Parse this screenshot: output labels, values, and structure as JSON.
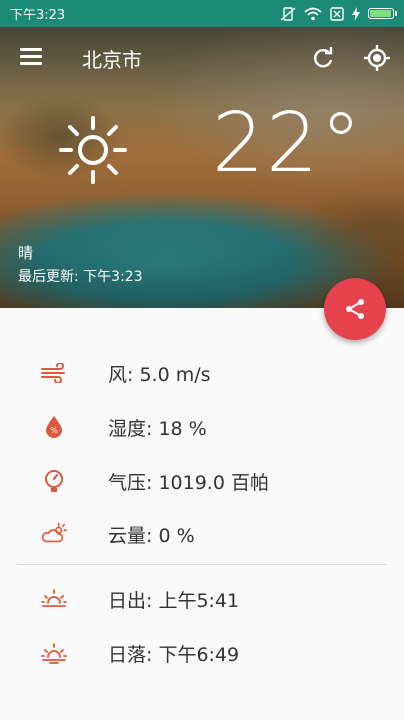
{
  "status_bar": {
    "time": "下午3:23"
  },
  "app_bar": {
    "city": "北京市",
    "icons": [
      "menu-icon",
      "refresh-icon",
      "location-icon"
    ]
  },
  "current": {
    "temperature": "22°",
    "condition": "晴",
    "updated_label": "最后更新:",
    "updated_time": "下午3:23",
    "weather_icon": "sun-icon"
  },
  "fab": {
    "icon": "share-icon"
  },
  "details": [
    {
      "icon": "wind-icon",
      "text": "风: 5.0 m/s"
    },
    {
      "icon": "humidity-icon",
      "text": "湿度: 18  %"
    },
    {
      "icon": "pressure-icon",
      "text": "气压: 1019.0 百帕"
    },
    {
      "icon": "cloud-icon",
      "text": "云量: 0 %"
    }
  ],
  "sun": [
    {
      "icon": "sunrise-icon",
      "text": "日出: 上午5:41"
    },
    {
      "icon": "sunset-icon",
      "text": "日落: 下午6:49"
    }
  ],
  "colors": {
    "status_bar": "#1b8a76",
    "accent": "#e8424f",
    "detail_icon": "#e0583b"
  }
}
